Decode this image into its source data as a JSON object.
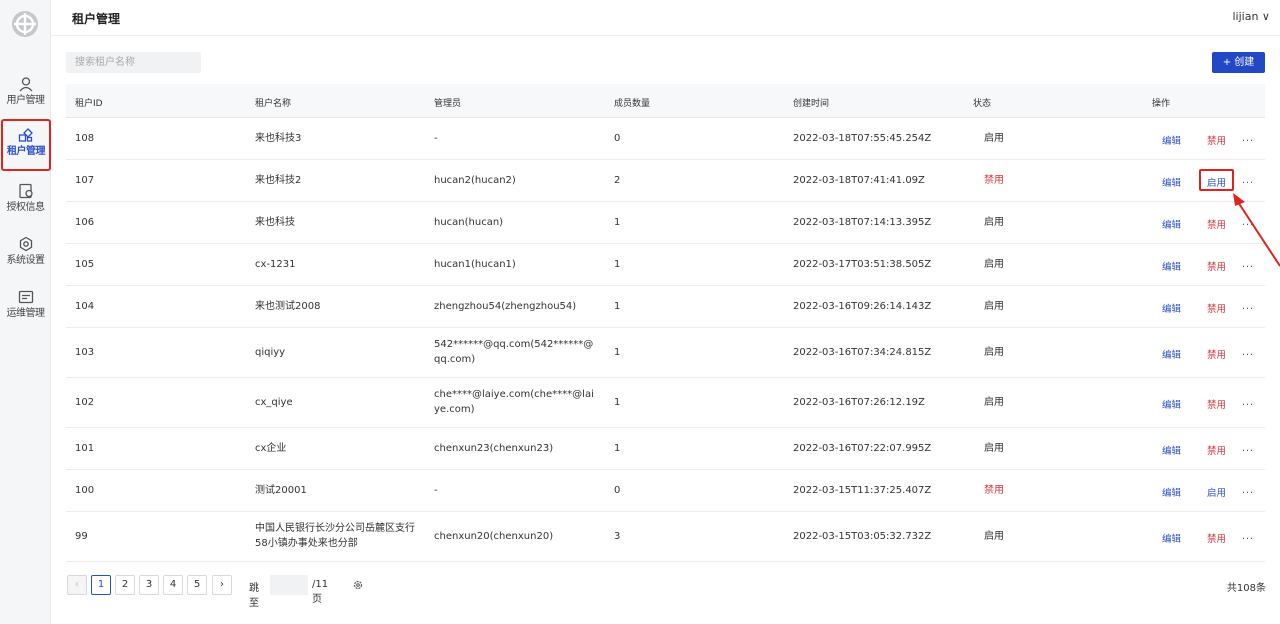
{
  "sidebar": {
    "items": [
      {
        "label": "用户管理",
        "icon": "user-icon"
      },
      {
        "label": "租户管理",
        "icon": "tenant-icon",
        "active": true
      },
      {
        "label": "授权信息",
        "icon": "license-icon"
      },
      {
        "label": "系统设置",
        "icon": "gear-icon"
      },
      {
        "label": "运维管理",
        "icon": "ops-icon"
      }
    ]
  },
  "header": {
    "title": "租户管理",
    "user": "lijian ∨"
  },
  "search": {
    "placeholder": "搜索租户名称"
  },
  "create_label": "+ 创建",
  "columns": [
    "租户ID",
    "租户名称",
    "管理员",
    "成员数量",
    "创建时间",
    "状态",
    "操作"
  ],
  "rows": [
    {
      "id": "108",
      "name": "来也科技3",
      "admin": "-",
      "members": "0",
      "created": "2022-03-18T07:55:45.254Z",
      "status": "启用",
      "edit": "编辑",
      "toggle": "禁用",
      "more": "..."
    },
    {
      "id": "107",
      "name": "来也科技2",
      "admin": "hucan2(hucan2)",
      "members": "2",
      "created": "2022-03-18T07:41:41.09Z",
      "status": "禁用",
      "edit": "编辑",
      "toggle": "启用",
      "more": "..."
    },
    {
      "id": "106",
      "name": "来也科技",
      "admin": "hucan(hucan)",
      "members": "1",
      "created": "2022-03-18T07:14:13.395Z",
      "status": "启用",
      "edit": "编辑",
      "toggle": "禁用",
      "more": "..."
    },
    {
      "id": "105",
      "name": "cx-1231",
      "admin": "hucan1(hucan1)",
      "members": "1",
      "created": "2022-03-17T03:51:38.505Z",
      "status": "启用",
      "edit": "编辑",
      "toggle": "禁用",
      "more": "..."
    },
    {
      "id": "104",
      "name": "来也测试2008",
      "admin": "zhengzhou54(zhengzhou54)",
      "members": "1",
      "created": "2022-03-16T09:26:14.143Z",
      "status": "启用",
      "edit": "编辑",
      "toggle": "禁用",
      "more": "..."
    },
    {
      "id": "103",
      "name": "qiqiyy",
      "admin": "542******@qq.com(542******@qq.com)",
      "members": "1",
      "created": "2022-03-16T07:34:24.815Z",
      "status": "启用",
      "edit": "编辑",
      "toggle": "禁用",
      "more": "..."
    },
    {
      "id": "102",
      "name": "cx_qiye",
      "admin": "che****@laiye.com(che****@laiye.com)",
      "members": "1",
      "created": "2022-03-16T07:26:12.19Z",
      "status": "启用",
      "edit": "编辑",
      "toggle": "禁用",
      "more": "..."
    },
    {
      "id": "101",
      "name": "cx企业",
      "admin": "chenxun23(chenxun23)",
      "members": "1",
      "created": "2022-03-16T07:22:07.995Z",
      "status": "启用",
      "edit": "编辑",
      "toggle": "禁用",
      "more": "..."
    },
    {
      "id": "100",
      "name": "测试20001",
      "admin": "-",
      "members": "0",
      "created": "2022-03-15T11:37:25.407Z",
      "status": "禁用",
      "edit": "编辑",
      "toggle": "启用",
      "more": "..."
    },
    {
      "id": "99",
      "name": "中国人民银行长沙分公司岳麓区支行58小镇办事处来也分部",
      "admin": "chenxun20(chenxun20)",
      "members": "3",
      "created": "2022-03-15T03:05:32.732Z",
      "status": "启用",
      "edit": "编辑",
      "toggle": "禁用",
      "more": "..."
    }
  ],
  "pagination": {
    "prev": "‹",
    "pages": [
      "1",
      "2",
      "3",
      "4",
      "5"
    ],
    "current": "1",
    "next": "›",
    "jump_label": "跳至",
    "page_suffix": "/11页",
    "settings_icon": "gear-icon",
    "total": "共108条"
  },
  "colors": {
    "accent": "#2348c6",
    "danger": "#d9363e",
    "highlight": "#e0231c"
  }
}
